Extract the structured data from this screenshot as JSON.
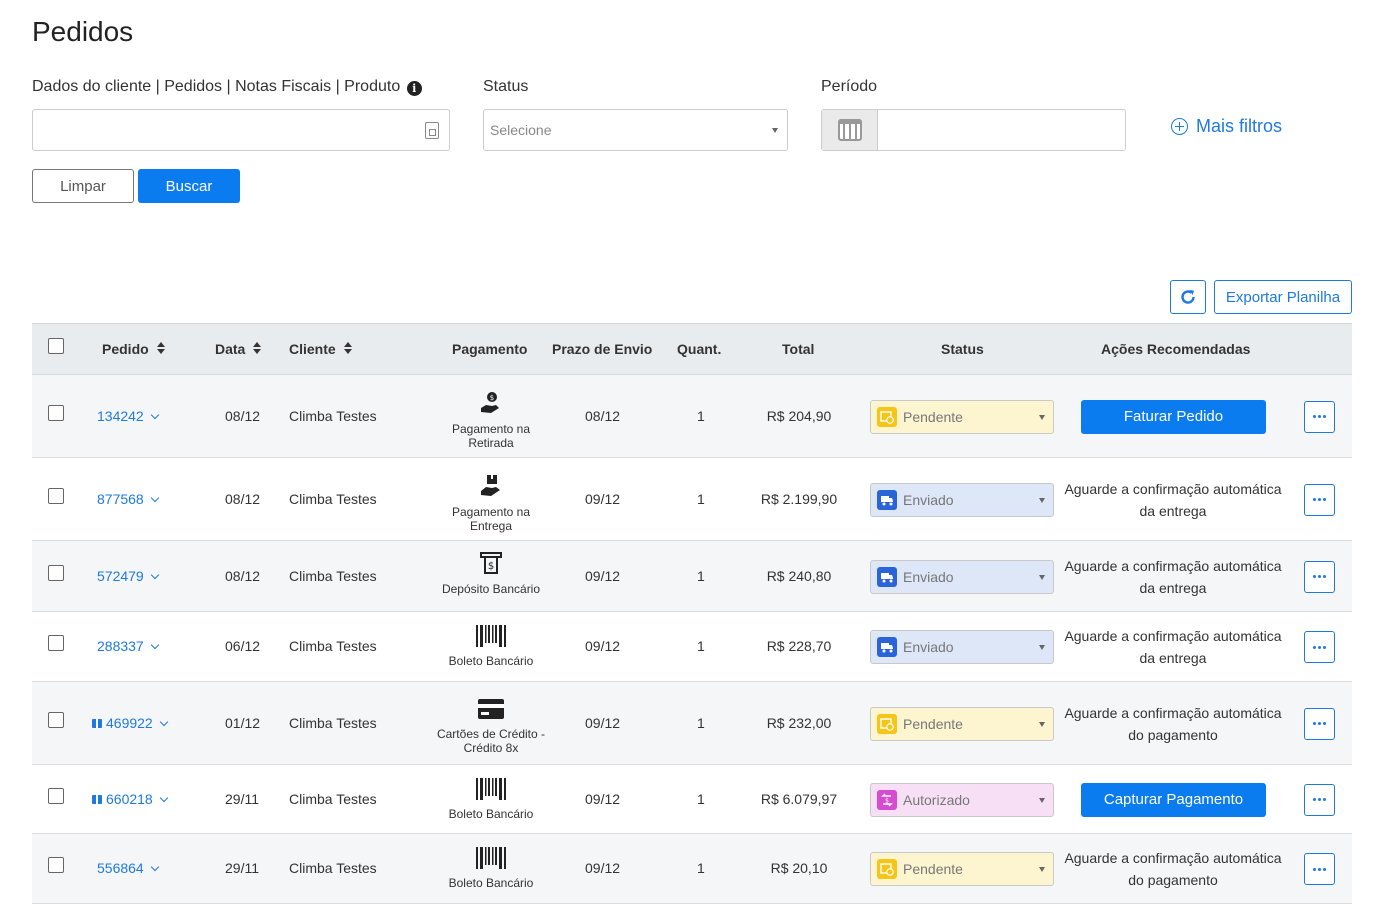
{
  "page": {
    "title": "Pedidos"
  },
  "filters": {
    "search_label": "Dados do cliente | Pedidos | Notas Fiscais | Produto",
    "search_value": "",
    "status_label": "Status",
    "status_placeholder": "Selecione",
    "period_label": "Período",
    "period_value": "",
    "more_filters_label": "Mais filtros",
    "clear_label": "Limpar",
    "search_button_label": "Buscar"
  },
  "toolbar": {
    "export_label": "Exportar Planilha"
  },
  "table": {
    "headers": {
      "order": "Pedido",
      "date": "Data",
      "client": "Cliente",
      "payment": "Pagamento",
      "shipping": "Prazo de Envio",
      "qty": "Quant.",
      "total": "Total",
      "status": "Status",
      "actions": "Ações Recomendadas"
    },
    "rows": [
      {
        "order": "134242",
        "gift": false,
        "date": "08/12",
        "client": "Climba Testes",
        "payment": "Pagamento na Retirada",
        "payment_icon": "hand-money-icon",
        "shipping": "08/12",
        "qty": "1",
        "total": "R$ 204,90",
        "status": "Pendente",
        "status_kind": "pendente",
        "action_button": "Faturar Pedido",
        "action_text": ""
      },
      {
        "order": "877568",
        "gift": false,
        "date": "08/12",
        "client": "Climba Testes",
        "payment": "Pagamento na Entrega",
        "payment_icon": "hand-box-icon",
        "shipping": "09/12",
        "qty": "1",
        "total": "R$ 2.199,90",
        "status": "Enviado",
        "status_kind": "enviado",
        "action_button": "",
        "action_text": "Aguarde a confirmação automática da entrega"
      },
      {
        "order": "572479",
        "gift": false,
        "date": "08/12",
        "client": "Climba Testes",
        "payment": "Depósito Bancário",
        "payment_icon": "bank-deposit-icon",
        "shipping": "09/12",
        "qty": "1",
        "total": "R$ 240,80",
        "status": "Enviado",
        "status_kind": "enviado",
        "action_button": "",
        "action_text": "Aguarde a confirmação automática da entrega"
      },
      {
        "order": "288337",
        "gift": false,
        "date": "06/12",
        "client": "Climba Testes",
        "payment": "Boleto Bancário",
        "payment_icon": "barcode-icon",
        "shipping": "09/12",
        "qty": "1",
        "total": "R$ 228,70",
        "status": "Enviado",
        "status_kind": "enviado",
        "action_button": "",
        "action_text": "Aguarde a confirmação automática da entrega"
      },
      {
        "order": "469922",
        "gift": true,
        "date": "01/12",
        "client": "Climba Testes",
        "payment": "Cartões de Crédito - Crédito 8x",
        "payment_icon": "credit-card-icon",
        "shipping": "09/12",
        "qty": "1",
        "total": "R$ 232,00",
        "status": "Pendente",
        "status_kind": "pendente",
        "action_button": "",
        "action_text": "Aguarde a confirmação automática do pagamento"
      },
      {
        "order": "660218",
        "gift": true,
        "date": "29/11",
        "client": "Climba Testes",
        "payment": "Boleto Bancário",
        "payment_icon": "barcode-icon",
        "shipping": "09/12",
        "qty": "1",
        "total": "R$ 6.079,97",
        "status": "Autorizado",
        "status_kind": "autorizado",
        "action_button": "Capturar Pagamento",
        "action_text": ""
      },
      {
        "order": "556864",
        "gift": false,
        "date": "29/11",
        "client": "Climba Testes",
        "payment": "Boleto Bancário",
        "payment_icon": "barcode-icon",
        "shipping": "09/12",
        "qty": "1",
        "total": "R$ 20,10",
        "status": "Pendente",
        "status_kind": "pendente",
        "action_button": "",
        "action_text": "Aguarde a confirmação automática do pagamento"
      }
    ]
  },
  "colors": {
    "primary": "#0a7cf0",
    "link": "#1f7ae0",
    "pendente": "#f5c518",
    "enviado": "#2b64d8",
    "autorizado": "#d64bcf"
  }
}
